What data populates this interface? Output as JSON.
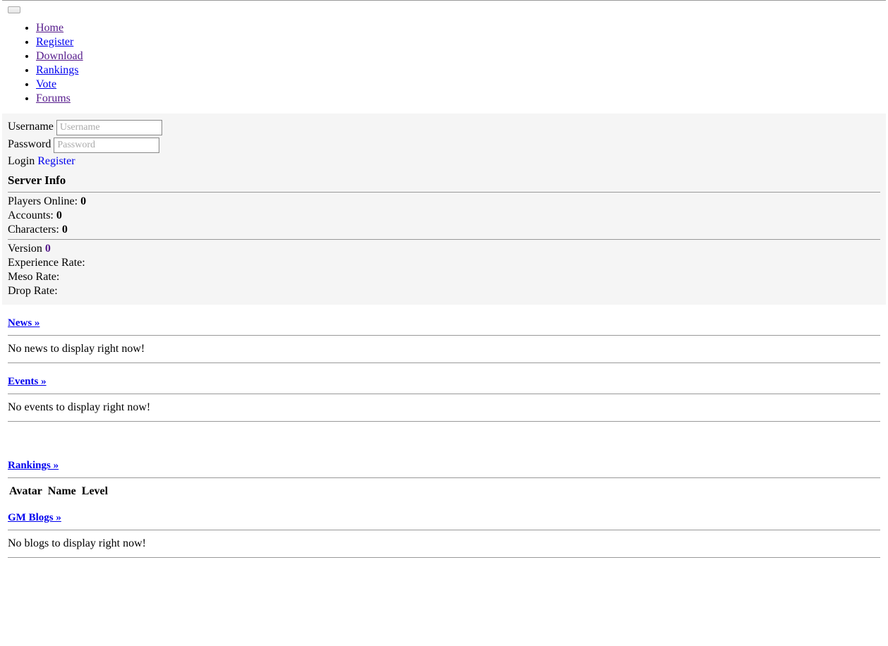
{
  "nav": {
    "items": [
      {
        "label": "Home",
        "visited": true
      },
      {
        "label": "Register",
        "visited": false
      },
      {
        "label": "Download",
        "visited": true
      },
      {
        "label": "Rankings",
        "visited": false
      },
      {
        "label": "Vote",
        "visited": false
      },
      {
        "label": "Forums",
        "visited": true
      }
    ]
  },
  "login": {
    "username_label": "Username",
    "username_placeholder": "Username",
    "password_label": "Password",
    "password_placeholder": "Password",
    "login_label": "Login",
    "register_label": "Register"
  },
  "server_info": {
    "title": "Server Info",
    "players_online_label": "Players Online: ",
    "players_online_value": "0",
    "accounts_label": "Accounts: ",
    "accounts_value": "0",
    "characters_label": "Characters: ",
    "characters_value": "0",
    "version_label": "Version ",
    "version_value": "0",
    "exp_rate_label": "Experience Rate:",
    "meso_rate_label": "Meso Rate:",
    "drop_rate_label": "Drop Rate:"
  },
  "sections": {
    "news": {
      "heading": "News »",
      "empty": "No news to display right now!"
    },
    "events": {
      "heading": "Events »",
      "empty": "No events to display right now!"
    },
    "rankings": {
      "heading": "Rankings »",
      "columns": [
        "Avatar",
        "Name",
        "Level"
      ]
    },
    "gmblogs": {
      "heading": "GM Blogs »",
      "empty": "No blogs to display right now!"
    }
  }
}
